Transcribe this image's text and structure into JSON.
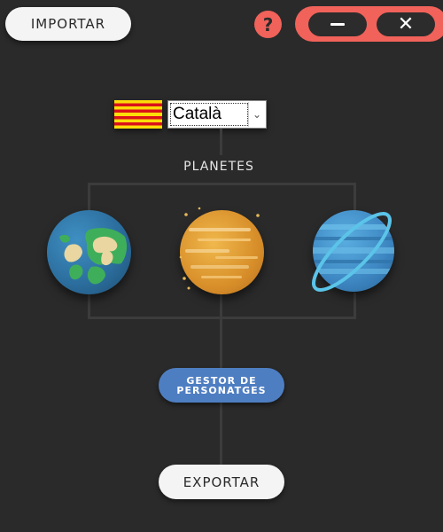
{
  "header": {
    "import_label": "IMPORTAR",
    "help_label": "?",
    "minimize_icon": "minimize-icon",
    "close_icon": "close-icon",
    "accent_color": "#f0625a"
  },
  "language": {
    "flag": "catalan-flag",
    "selected": "Català",
    "options": [
      "Català"
    ]
  },
  "planets": {
    "title": "PLANETES",
    "items": [
      {
        "name": "earth",
        "icon": "earth-icon"
      },
      {
        "name": "venus",
        "icon": "venus-icon"
      },
      {
        "name": "neptune",
        "icon": "neptune-icon"
      }
    ]
  },
  "characters_button": {
    "label": "GESTOR DE PERSONATGES",
    "color": "#4e7ec2"
  },
  "footer": {
    "export_label": "EXPORTAR"
  },
  "colors": {
    "background": "#2a2a2a",
    "button": "#f4f4f4",
    "lines": "#3c3c3c"
  }
}
